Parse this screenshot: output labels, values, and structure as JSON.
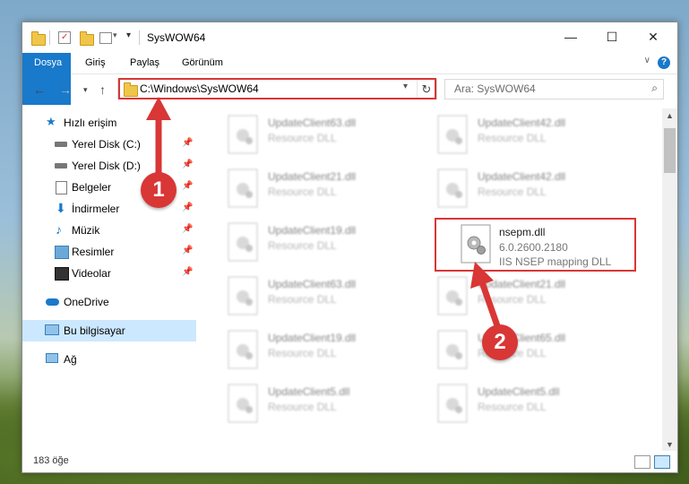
{
  "window": {
    "title": "SysWOW64"
  },
  "ribbon": {
    "tabs": [
      "Dosya",
      "Giriş",
      "Paylaş",
      "Görünüm"
    ],
    "help_label": "?"
  },
  "address": {
    "path": "C:\\Windows\\SysWOW64"
  },
  "search": {
    "placeholder": "Ara: SysWOW64"
  },
  "nav": {
    "items": [
      {
        "label": "Hızlı erişim",
        "icon": "star-icon"
      },
      {
        "label": "Yerel Disk (C:)",
        "icon": "drive-icon"
      },
      {
        "label": "Yerel Disk (D:)",
        "icon": "drive-icon"
      },
      {
        "label": "Belgeler",
        "icon": "documents-icon"
      },
      {
        "label": "İndirmeler",
        "icon": "download-icon"
      },
      {
        "label": "Müzik",
        "icon": "music-icon"
      },
      {
        "label": "Resimler",
        "icon": "pictures-icon"
      },
      {
        "label": "Videolar",
        "icon": "video-icon"
      },
      {
        "label": "OneDrive",
        "icon": "cloud-icon"
      },
      {
        "label": "Bu bilgisayar",
        "icon": "computer-icon"
      },
      {
        "label": "Ağ",
        "icon": "network-icon"
      }
    ]
  },
  "files": [
    {
      "name": "UpdateClient63.dll",
      "meta1": "Resource DLL"
    },
    {
      "name": "UpdateClient42.dll",
      "meta1": "Resource DLL"
    },
    {
      "name": "UpdateClient21.dll",
      "meta1": "Resource DLL"
    },
    {
      "name": "UpdateClient42.dll",
      "meta1": "Resource DLL"
    },
    {
      "name": "UpdateClient19.dll",
      "meta1": "Resource DLL"
    },
    {
      "name": "nsepm.dll",
      "meta1": "6.0.2600.2180",
      "meta2": "IIS NSEP mapping DLL"
    },
    {
      "name": "UpdateClient63.dll",
      "meta1": "Resource DLL"
    },
    {
      "name": "UpdateClient21.dll",
      "meta1": "Resource DLL"
    },
    {
      "name": "UpdateClient19.dll",
      "meta1": "Resource DLL"
    },
    {
      "name": "UpdateClient65.dll",
      "meta1": "Resource DLL"
    },
    {
      "name": "UpdateClient5.dll",
      "meta1": "Resource DLL"
    },
    {
      "name": "UpdateClient5.dll",
      "meta1": "Resource DLL"
    }
  ],
  "status": {
    "count": "183 öğe"
  },
  "annotations": {
    "step1": "1",
    "step2": "2",
    "color": "#d93636"
  }
}
